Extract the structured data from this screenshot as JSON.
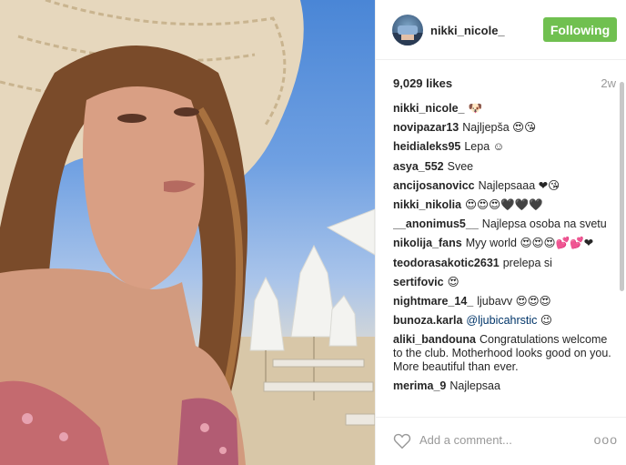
{
  "post": {
    "username": "nikki_nicole_",
    "follow_label": "Following",
    "likes": "9,029 likes",
    "age": "2w",
    "add_comment_placeholder": "Add a comment...",
    "more_label": "ooo"
  },
  "colors": {
    "follow_bg": "#70c050",
    "mention": "#003569"
  },
  "icons": {
    "like": "heart-outline-icon",
    "more": "ellipsis-icon"
  },
  "comments": [
    {
      "user": "nikki_nicole_",
      "text": "🐶"
    },
    {
      "user": "novipazar13",
      "text": "Najljepša 😍😘"
    },
    {
      "user": "heidialeks95",
      "text": "Lepa ☺"
    },
    {
      "user": "asya_552",
      "text": "Svee"
    },
    {
      "user": "ancijosanovicc",
      "text": "Najlepsaaa ❤😘"
    },
    {
      "user": "nikki_nikolia",
      "text": "😍😍😍🖤🖤🖤"
    },
    {
      "user": "__anonimus5__",
      "text": "Najlepsa osoba na svetu"
    },
    {
      "user": "nikolija_fans",
      "text": "Myy world 😍😍😍💕💕❤"
    },
    {
      "user": "teodorasakotic2631",
      "text": "prelepa si"
    },
    {
      "user": "sertifovic",
      "text": "😍"
    },
    {
      "user": "nightmare_14_",
      "text": "ljubavv 😍😍😍"
    },
    {
      "user": "bunoza.karla",
      "text": "",
      "mention": "@ljubicahrstic",
      "after": " 😉"
    },
    {
      "user": "aliki_bandouna",
      "text": "Congratulations welcome to the club. Motherhood looks good on you. More beautiful than ever."
    },
    {
      "user": "merima_9",
      "text": "Najlepsaa"
    }
  ]
}
